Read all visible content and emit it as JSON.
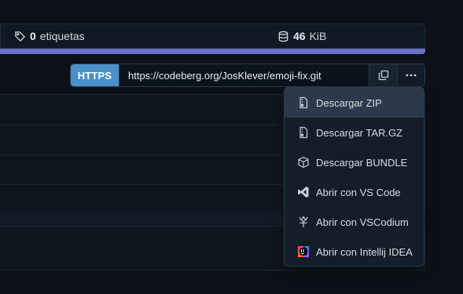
{
  "stats": {
    "tags_count": "0",
    "tags_label": "etiquetas",
    "size_value": "46",
    "size_unit": "KiB"
  },
  "colors": {
    "language_bar": "#6b71c6",
    "https_button": "#4a90c9",
    "menu_active": "#2b3a4a"
  },
  "clone": {
    "protocol_label": "HTTPS",
    "url": "https://codeberg.org/JosKlever/emoji-fix.git",
    "copy_icon": "copy-icon",
    "more_icon": "kebab-horizontal-icon"
  },
  "menu": {
    "items": [
      {
        "label": "Descargar ZIP",
        "icon": "file-zip-icon",
        "active": true
      },
      {
        "label": "Descargar TAR.GZ",
        "icon": "file-zip-icon",
        "active": false
      },
      {
        "label": "Descargar BUNDLE",
        "icon": "package-icon",
        "active": false
      },
      {
        "label": "Abrir con VS Code",
        "icon": "vscode-icon",
        "active": false
      },
      {
        "label": "Abrir con VSCodium",
        "icon": "vscodium-icon",
        "active": false
      },
      {
        "label": "Abrir con Intellij IDEA",
        "icon": "intellij-icon",
        "active": false
      }
    ]
  }
}
